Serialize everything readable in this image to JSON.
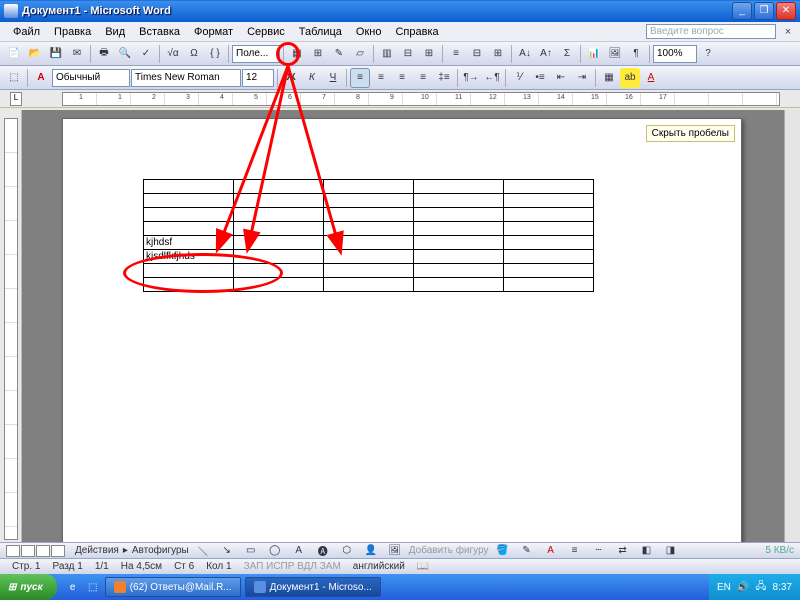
{
  "titlebar": {
    "title": "Документ1 - Microsoft Word"
  },
  "menu": {
    "items": [
      "Файл",
      "Правка",
      "Вид",
      "Вставка",
      "Формат",
      "Сервис",
      "Таблица",
      "Окно",
      "Справка"
    ],
    "question_placeholder": "Введите вопрос"
  },
  "toolbar1": {
    "zoom": "100%",
    "formula": "√α",
    "polo": "Поле..."
  },
  "toolbar2": {
    "style_marker": "A",
    "style": "Обычный",
    "font": "Times New Roman",
    "size": "12"
  },
  "ruler": {
    "marks": [
      "1",
      "1",
      "2",
      "3",
      "4",
      "5",
      "6",
      "7",
      "8",
      "9",
      "10",
      "11",
      "12",
      "13",
      "14",
      "15",
      "16",
      "17"
    ]
  },
  "page": {
    "hide_spaces": "Скрыть пробелы",
    "table_rows": 8,
    "table_cols": 5,
    "cell_r5c1": "kjhdsf",
    "cell_r6c1": "kjsdlfkfjhds"
  },
  "status_upper": {
    "actions": "Действия",
    "autoshapes": "Автофигуры",
    "add_shape": "Добавить фигуру"
  },
  "status_main": {
    "page": "Стр. 1",
    "section": "Разд 1",
    "pages": "1/1",
    "at": "На 4,5см",
    "line": "Ст 6",
    "col": "Кол 1",
    "flags": "ЗАП  ИСПР  ВДЛ  ЗАМ",
    "lang": "английский",
    "kb": "5 КВ/с"
  },
  "taskbar": {
    "start": "пуск",
    "items": [
      {
        "label": "(62) Ответы@Mail.R...",
        "color": "#f08030"
      },
      {
        "label": "Документ1 - Microso...",
        "color": "#5a8ee0"
      }
    ],
    "tray": {
      "lang": "EN",
      "time": "8:37"
    }
  },
  "annot": {
    "arrow_src": "table-draw-button"
  }
}
